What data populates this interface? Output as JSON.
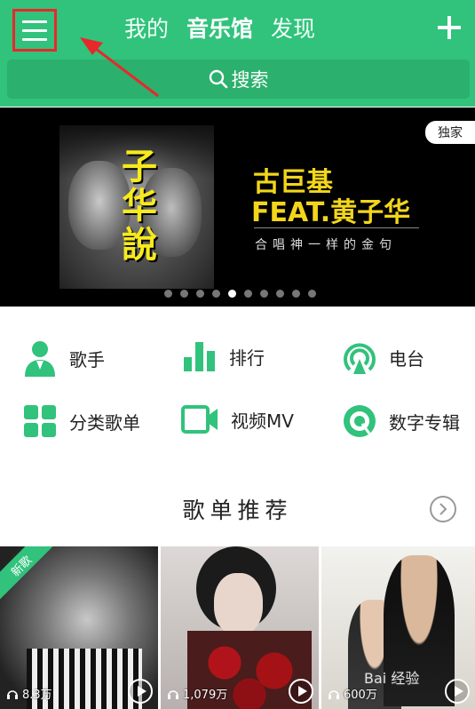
{
  "header": {
    "tabs": [
      {
        "label": "我的",
        "active": false
      },
      {
        "label": "音乐馆",
        "active": true
      },
      {
        "label": "发现",
        "active": false
      }
    ],
    "search_label": "搜索",
    "menu_icon": "menu-icon",
    "plus_icon": "plus-icon",
    "accent_color": "#31c27c",
    "highlight_color": "#e8282b"
  },
  "banner": {
    "cover_title": "子华說",
    "title_line1": "古巨基",
    "title_line2": "FEAT.黄子华",
    "subtitle": "合唱神一样的金句",
    "badge": "独家",
    "dot_count": 10,
    "active_dot": 4
  },
  "categories": [
    {
      "label": "歌手",
      "icon": "singer-icon"
    },
    {
      "label": "排行",
      "icon": "chart-icon"
    },
    {
      "label": "电台",
      "icon": "radio-icon"
    },
    {
      "label": "分类歌单",
      "icon": "grid-icon"
    },
    {
      "label": "视频MV",
      "icon": "video-icon"
    },
    {
      "label": "数字专辑",
      "icon": "album-icon"
    }
  ],
  "section": {
    "title": "歌单推荐",
    "more_icon": "chevron-right-icon"
  },
  "playlists": [
    {
      "tag": "新歌",
      "count": "8.3万"
    },
    {
      "count": "1,079万"
    },
    {
      "count": "600万"
    }
  ],
  "watermark": "Bai 经验"
}
